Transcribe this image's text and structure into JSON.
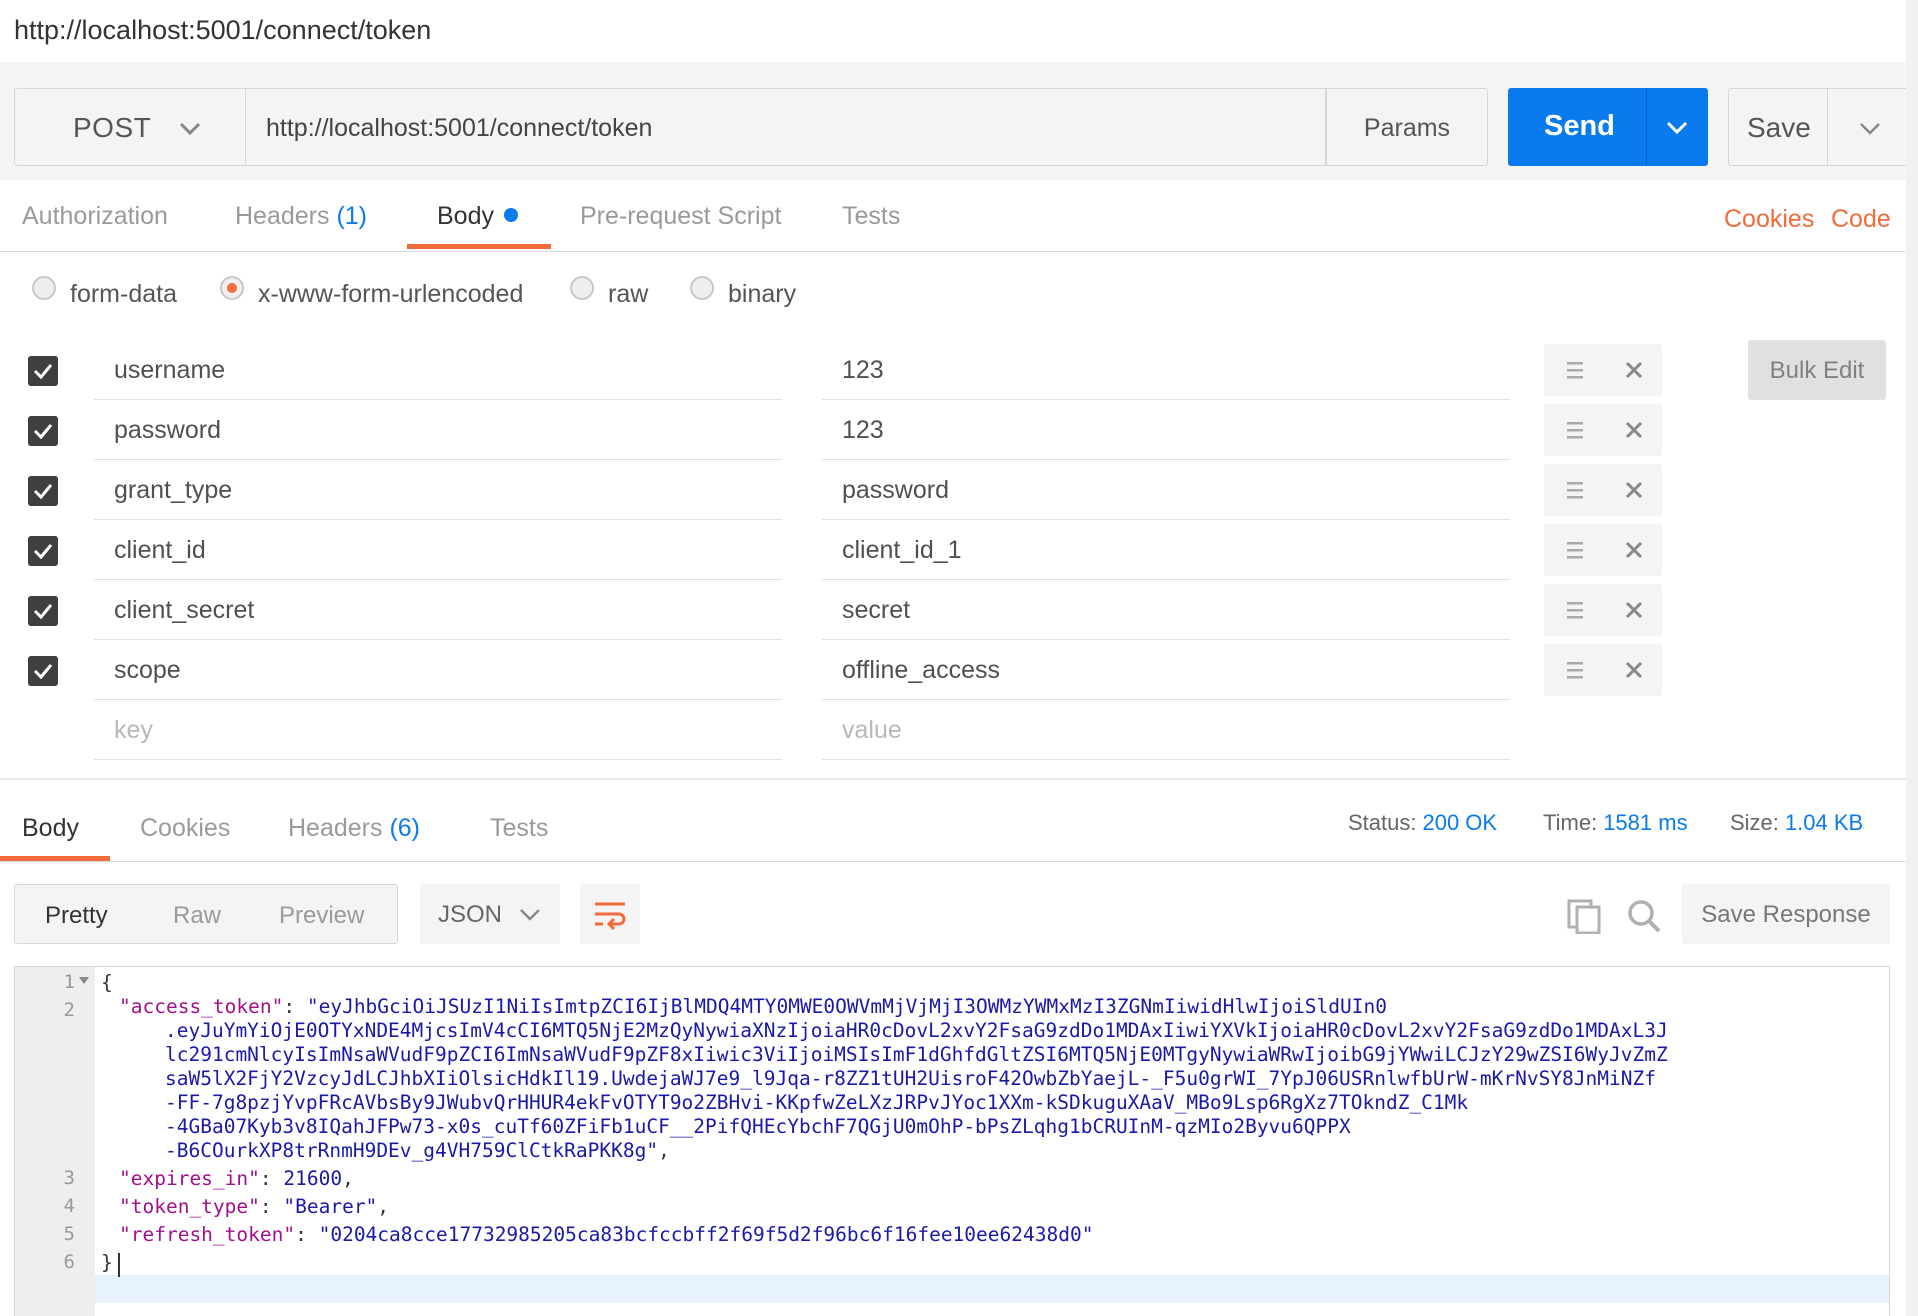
{
  "window": {
    "title": "http://localhost:5001/connect/token"
  },
  "request": {
    "method": "POST",
    "url": "http://localhost:5001/connect/token",
    "params_label": "Params",
    "send_label": "Send",
    "save_label": "Save"
  },
  "req_tabs": {
    "authorization": "Authorization",
    "headers": "Headers",
    "headers_count": "(1)",
    "body": "Body",
    "prerequest": "Pre-request Script",
    "tests": "Tests",
    "cookies": "Cookies",
    "code": "Code"
  },
  "body_types": {
    "form_data": "form-data",
    "urlencoded": "x-www-form-urlencoded",
    "raw": "raw",
    "binary": "binary",
    "selected": "x-www-form-urlencoded"
  },
  "params": [
    {
      "key": "username",
      "value": "123"
    },
    {
      "key": "password",
      "value": "123"
    },
    {
      "key": "grant_type",
      "value": "password"
    },
    {
      "key": "client_id",
      "value": "client_id_1"
    },
    {
      "key": "client_secret",
      "value": "secret"
    },
    {
      "key": "scope",
      "value": "offline_access"
    }
  ],
  "new_param": {
    "key_placeholder": "key",
    "value_placeholder": "value"
  },
  "bulk_edit_label": "Bulk Edit",
  "resp_tabs": {
    "body": "Body",
    "cookies": "Cookies",
    "headers": "Headers",
    "headers_count": "(6)",
    "tests": "Tests"
  },
  "status": {
    "status_label": "Status:",
    "status_value": "200 OK",
    "time_label": "Time:",
    "time_value": "1581 ms",
    "size_label": "Size:",
    "size_value": "1.04 KB"
  },
  "view": {
    "pretty": "Pretty",
    "raw": "Raw",
    "preview": "Preview",
    "format": "JSON",
    "save_response": "Save Response"
  },
  "response_lines": [
    {
      "n": "1",
      "text": "{"
    },
    {
      "n": "2",
      "key": "\"access_token\"",
      "str": [
        "\"eyJhbGciOiJSUzI1NiIsImtpZCI6IjBlMDQ4MTY0MWE0OWVmMjVjMjI3OWMzYWMxMzI3ZGNmIiwidHlwIjoiSldUIn0",
        ".eyJuYmYiOjE0OTYxNDE4MjcsImV4cCI6MTQ5NjE2MzQyNywiaXNzIjoiaHR0cDovL2xvY2FsaG9zdDo1MDAxIiwiYXVkIjoiaHR0cDovL2xvY2FsaG9zdDo1MDAxL3J",
        "lc291cmNlcyIsImNsaWVudF9pZCI6ImNsaWVudF9pZF8xIiwic3ViIjoiMSIsImF1dGhfdGltZSI6MTQ5NjE0MTgyNywiaWRwIjoibG9jYWwiLCJzY29wZSI6WyJvZmZ",
        "saW5lX2FjY2VzcyJdLCJhbXIiOlsicHdkIl19.UwdejaWJ7e9_l9Jqa-r8ZZ1tUH2UisroF42OwbZbYaejL-_F5u0grWI_7YpJ06USRnlwfbUrW-mKrNvSY8JnMiNZf",
        "-FF-7g8pzjYvpFRcAVbsBy9JWubvQrHHUR4ekFvOTYT9o2ZBHvi-KKpfwZeLXzJRPvJYoc1XXm-kSDkuguXAaV_MBo9Lsp6RgXz7TOkndZ_C1Mk",
        "-4GBa07Kyb3v8IQahJFPw73-x0s_cuTf60ZFiFb1uCF__2PifQHEcYbchF7QGjU0mOhP-bPsZLqhg1bCRUInM-qzMIo2Byvu6QPPX",
        "-B6COurkXP8trRnmH9DEv_g4VH759ClCtkRaPKK8g\""
      ]
    },
    {
      "n": "3",
      "key": "\"expires_in\"",
      "num": "21600"
    },
    {
      "n": "4",
      "key": "\"token_type\"",
      "str1": "\"Bearer\""
    },
    {
      "n": "5",
      "key": "\"refresh_token\"",
      "str1": "\"0204ca8cce17732985205ca83bcfccbff2f69f5d2f96bc6f16fee10ee62438d0\""
    },
    {
      "n": "6",
      "text": "}"
    }
  ],
  "icons": {
    "method_chevron": "chevron-down-icon",
    "send_chevron": "chevron-down-icon",
    "save_chevron": "chevron-down-icon",
    "drag": "drag-handle-icon",
    "remove": "close-icon",
    "wrap": "wrap-lines-icon",
    "copy": "copy-icon",
    "search": "search-icon"
  },
  "colors": {
    "accent": "#097bed",
    "active_tab": "#f26b3a",
    "key": "#a0118c",
    "string": "#1a1aa6"
  }
}
